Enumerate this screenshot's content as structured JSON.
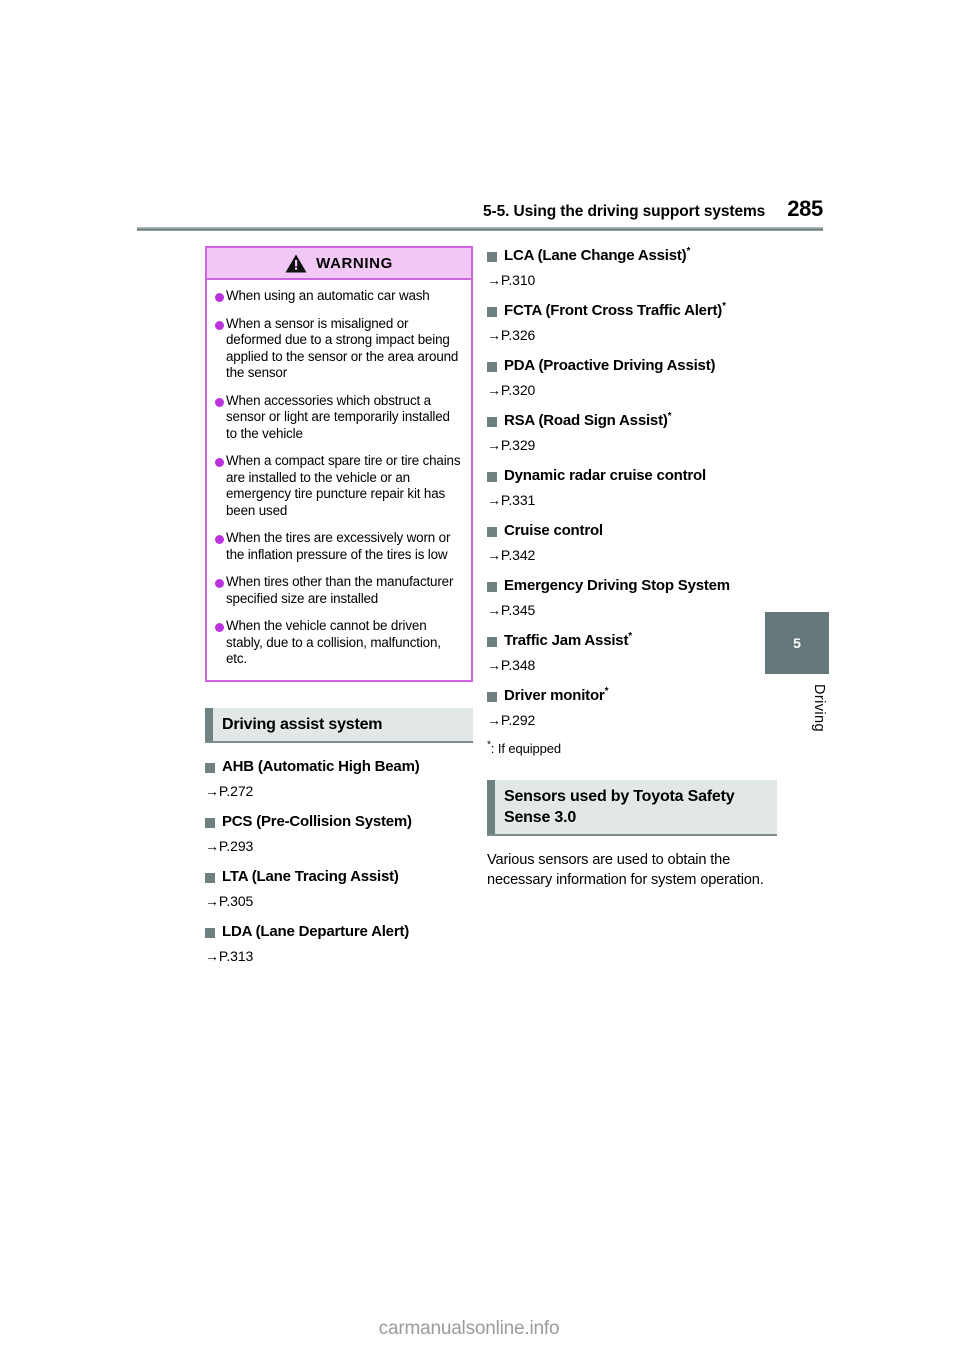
{
  "header": {
    "chapter_title": "5-5. Using the driving support systems",
    "page_number": "285"
  },
  "chapter_tab": {
    "number": "5",
    "label": "Driving"
  },
  "warning_box": {
    "title": "WARNING",
    "icon": "warning-triangle-icon",
    "border_color": "#cc66dd",
    "header_background": "#f2c8f7",
    "bullet_color": "#bb33dd",
    "items": [
      "When using an automatic car wash",
      "When a sensor is misaligned or deformed due to a strong impact being applied to the sensor or the area around the sensor",
      "When accessories which obstruct a sensor or light are temporarily installed to the vehicle",
      "When a compact spare tire or tire chains are installed to the vehicle or an emergency tire puncture repair kit has been used",
      "When the tires are excessively worn or the inflation pressure of the tires is low",
      "When tires other than the manufacturer specified size are installed",
      "When the vehicle cannot be driven stably, due to a collision, malfunction, etc."
    ]
  },
  "driving_assist_section": {
    "title": "Driving assist system",
    "marker_color": "#6e8080",
    "bar_color": "#6f8181",
    "background": "#e2e8e8",
    "items": [
      {
        "label": "AHB (Automatic High Beam)",
        "starred": false,
        "ref": "P.272"
      },
      {
        "label": "PCS (Pre-Collision System)",
        "starred": false,
        "ref": "P.293"
      },
      {
        "label": "LTA (Lane Tracing Assist)",
        "starred": false,
        "ref": "P.305"
      },
      {
        "label": "LDA (Lane Departure Alert)",
        "starred": false,
        "ref": "P.313"
      }
    ]
  },
  "right_column_items": [
    {
      "label": "LCA (Lane Change Assist)",
      "starred": true,
      "ref": "P.310"
    },
    {
      "label": "FCTA (Front Cross Traffic Alert)",
      "starred": true,
      "ref": "P.326"
    },
    {
      "label": "PDA (Proactive Driving Assist)",
      "starred": false,
      "ref": "P.320"
    },
    {
      "label": "RSA (Road Sign Assist)",
      "starred": true,
      "ref": "P.329"
    },
    {
      "label": "Dynamic radar cruise control",
      "starred": false,
      "ref": "P.331"
    },
    {
      "label": "Cruise control",
      "starred": false,
      "ref": "P.342"
    },
    {
      "label": "Emergency Driving Stop System",
      "starred": false,
      "ref": "P.345"
    },
    {
      "label": "Traffic Jam Assist",
      "starred": true,
      "ref": "P.348"
    },
    {
      "label": "Driver monitor",
      "starred": true,
      "ref": "P.292"
    }
  ],
  "footnote": {
    "marker": "*",
    "text": ": If equipped"
  },
  "sensors_section": {
    "title": "Sensors used by Toyota Safety Sense 3.0",
    "body": "Various sensors are used to obtain the necessary information for system operation."
  },
  "watermark": "carmanualsonline.info",
  "arrow_glyph": "→"
}
